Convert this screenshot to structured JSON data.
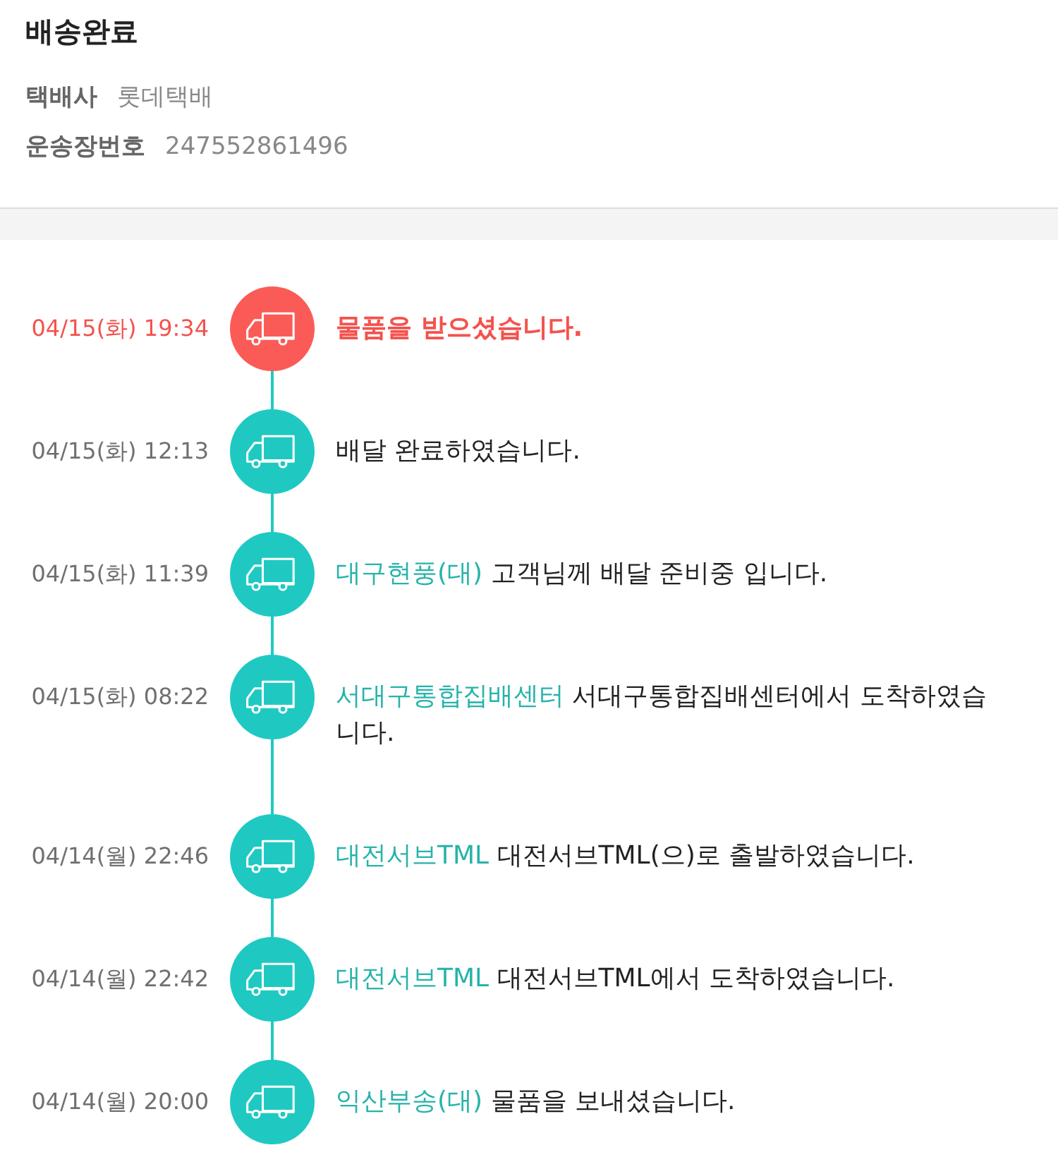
{
  "header": {
    "title": "배송완료",
    "fields": [
      {
        "label": "택배사",
        "value": "롯데택배"
      },
      {
        "label": "운송장번호",
        "value": "247552861496"
      }
    ]
  },
  "timeline": [
    {
      "time": "04/15(화) 19:34",
      "latest": true,
      "message": "물품을 받으셨습니다."
    },
    {
      "time": "04/15(화) 12:13",
      "latest": false,
      "message": "배달 완료하였습니다."
    },
    {
      "time": "04/15(화) 11:39",
      "latest": false,
      "location": "대구현풍(대)",
      "message": "고객님께 배달 준비중 입니다."
    },
    {
      "time": "04/15(화) 08:22",
      "latest": false,
      "location": "서대구통합집배센터",
      "message": "서대구통합집배센터에서 도착하였습니다."
    },
    {
      "time": "04/14(월) 22:46",
      "latest": false,
      "location": "대전서브TML",
      "message": "대전서브TML(으)로 출발하였습니다."
    },
    {
      "time": "04/14(월) 22:42",
      "latest": false,
      "location": "대전서브TML",
      "message": "대전서브TML에서 도착하였습니다."
    },
    {
      "time": "04/14(월) 20:00",
      "latest": false,
      "location": "익산부송(대)",
      "message": "물품을 보내셨습니다."
    }
  ]
}
